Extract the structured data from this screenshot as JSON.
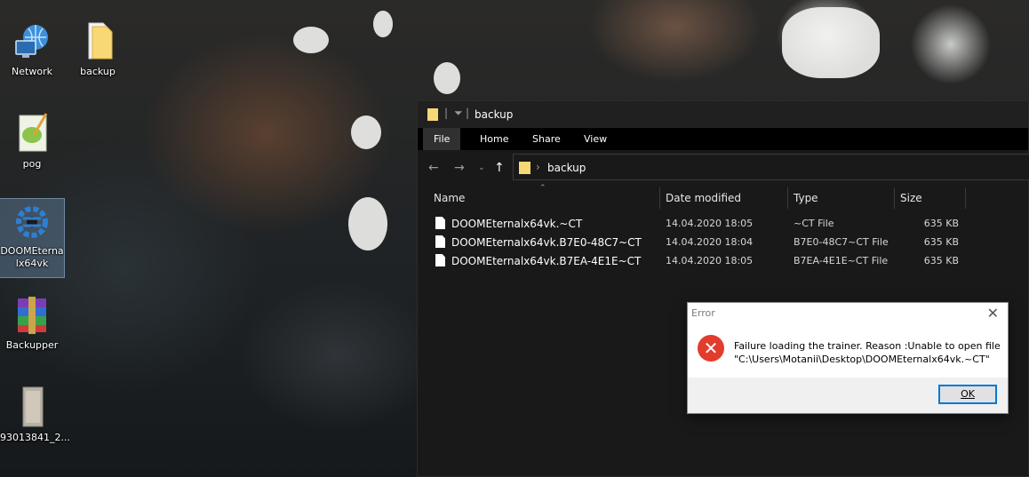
{
  "desktop": {
    "icons": [
      {
        "label": "Network",
        "icon": "network-icon"
      },
      {
        "label": "backup",
        "icon": "folder-icon"
      },
      {
        "label": "pog",
        "icon": "notepad-plus-plus-icon"
      },
      {
        "label": "DOOMEternalx64vk",
        "icon": "cheat-engine-icon"
      },
      {
        "label": "Backupper",
        "icon": "winrar-archive-icon"
      },
      {
        "label": "93013841_2...",
        "icon": "image-file-icon"
      }
    ]
  },
  "explorer": {
    "title": "backup",
    "ribbon_tabs": [
      "File",
      "Home",
      "Share",
      "View"
    ],
    "address": {
      "breadcrumb": "backup"
    },
    "columns": {
      "name": "Name",
      "date": "Date modified",
      "type": "Type",
      "size": "Size"
    },
    "files": [
      {
        "name": "DOOMEternalx64vk.~CT",
        "date": "14.04.2020 18:05",
        "type": "~CT File",
        "size": "635 KB"
      },
      {
        "name": "DOOMEternalx64vk.B7E0-48C7~CT",
        "date": "14.04.2020 18:04",
        "type": "B7E0-48C7~CT File",
        "size": "635 KB"
      },
      {
        "name": "DOOMEternalx64vk.B7EA-4E1E~CT",
        "date": "14.04.2020 18:05",
        "type": "B7EA-4E1E~CT File",
        "size": "635 KB"
      }
    ]
  },
  "dialog": {
    "title": "Error",
    "message_line1": "Failure loading the trainer. Reason :Unable to open file",
    "message_line2": "\"C:\\Users\\Motanii\\Desktop\\DOOMEternalx64vk.~CT\"",
    "ok_label": "OK",
    "close_glyph": "✕",
    "icon_glyph": "✕"
  },
  "colors": {
    "explorer_bg": "#191919",
    "error_red": "#e23c2d",
    "accent_blue": "#0078d7",
    "folder_yellow": "#f8d775"
  }
}
